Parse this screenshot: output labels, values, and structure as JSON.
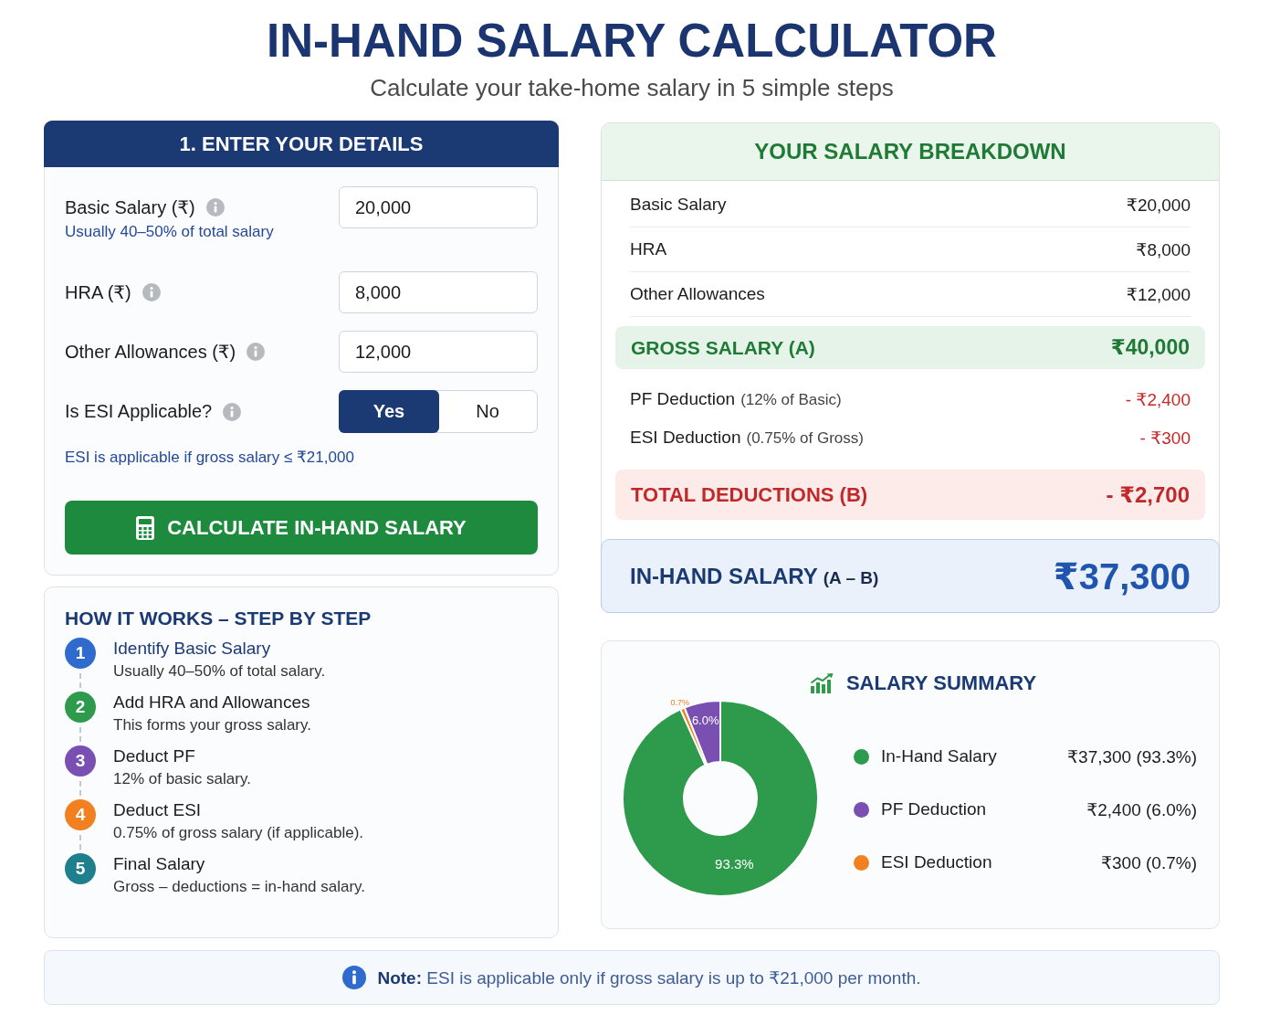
{
  "header": {
    "title": "IN-HAND SALARY CALCULATOR",
    "subtitle": "Calculate your take-home salary in 5 simple steps"
  },
  "details": {
    "title": "1. ENTER YOUR DETAILS",
    "fields": [
      {
        "label": "Basic Salary (₹)",
        "help_text": "Usually 40–50% of total salary",
        "value": "20,000"
      },
      {
        "label": "HRA (₹)",
        "value": "8,000"
      },
      {
        "label": "Other Allowances (₹)",
        "value": "12,000"
      }
    ],
    "esi": {
      "label": "Is ESI Applicable?",
      "options": [
        {
          "label": "Yes",
          "selected": true
        },
        {
          "label": "No",
          "selected": false
        }
      ],
      "help_text": "ESI is applicable if gross salary ≤ ₹21,000"
    },
    "button": "CALCULATE IN-HAND SALARY"
  },
  "steps": {
    "title": "HOW IT WORKS – STEP BY STEP",
    "items": [
      {
        "number": "1",
        "title": "Identify Basic Salary",
        "text": "Usually 40–50% of total salary.",
        "color": "#2f6bcf",
        "active": true
      },
      {
        "number": "2",
        "title": "Add HRA and Allowances",
        "text": "This forms your gross salary.",
        "color": "#2e9a4c",
        "active": false
      },
      {
        "number": "3",
        "title": "Deduct PF",
        "text": "12% of basic salary.",
        "color": "#7a4fb2",
        "active": false
      },
      {
        "number": "4",
        "title": "Deduct ESI",
        "text": "0.75% of gross salary (if applicable).",
        "color": "#f28021",
        "active": false
      },
      {
        "number": "5",
        "title": "Final Salary",
        "text": "Gross – deductions = in-hand salary.",
        "color": "#1f7f8c",
        "active": false
      }
    ]
  },
  "breakdown": {
    "title": "YOUR SALARY BREAKDOWN",
    "rows": [
      {
        "kind": "item",
        "label": "Basic Salary",
        "value": "₹20,000"
      },
      {
        "kind": "item",
        "label": "HRA",
        "value": "₹8,000"
      },
      {
        "kind": "item",
        "label": "Other Allowances",
        "value": "₹12,000"
      },
      {
        "kind": "gross",
        "label": "GROSS SALARY (A)",
        "value": "₹40,000"
      },
      {
        "kind": "deduction",
        "label": "PF Deduction",
        "note": "(12% of Basic)",
        "value": "- ₹2,400"
      },
      {
        "kind": "deduction",
        "label": "ESI Deduction",
        "note": "(0.75% of Gross)",
        "value": "- ₹300"
      },
      {
        "kind": "total",
        "label": "TOTAL DEDUCTIONS (B)",
        "value": "- ₹2,700"
      }
    ],
    "in_hand": {
      "label": "IN-HAND SALARY",
      "note": "(A – B)",
      "value": "₹37,300"
    }
  },
  "summary": {
    "title": "SALARY SUMMARY",
    "chart_data": {
      "type": "donut",
      "categories": [
        "In-Hand Salary",
        "PF Deduction",
        "ESI Deduction"
      ],
      "values": [
        93.3,
        6.0,
        0.7
      ],
      "value_labels": [
        "93.3%",
        "6.0%",
        "0.7%"
      ]
    },
    "legend": [
      {
        "value": "₹37,300 (93.3%)",
        "color": "#2e9a4c"
      },
      {
        "value": "₹2,400 (6.0%)",
        "color": "#7a4fb2"
      },
      {
        "value": "₹300 (0.7%)",
        "color": "#f28021"
      }
    ]
  },
  "note": "**Note:** ESI is applicable only if gross salary is up to ₹21,000 per month."
}
